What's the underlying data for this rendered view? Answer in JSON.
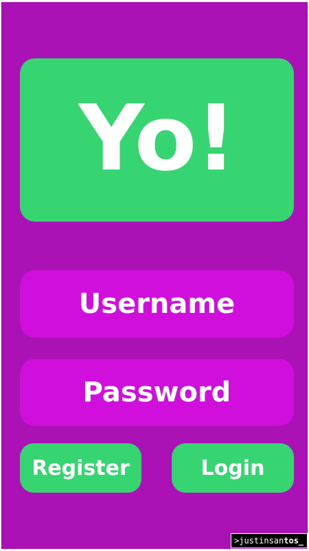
{
  "app": {
    "logo_text": "Yo!"
  },
  "form": {
    "username_placeholder": "Username",
    "password_placeholder": "Password",
    "register_label": "Register",
    "login_label": "Login"
  },
  "footer": {
    "credit_prefix": ">justinsan",
    "credit_suffix": "tos_"
  },
  "colors": {
    "background": "#ab12b6",
    "field": "#d10fdc",
    "accent_green": "#36d572",
    "text": "#ffffff"
  }
}
